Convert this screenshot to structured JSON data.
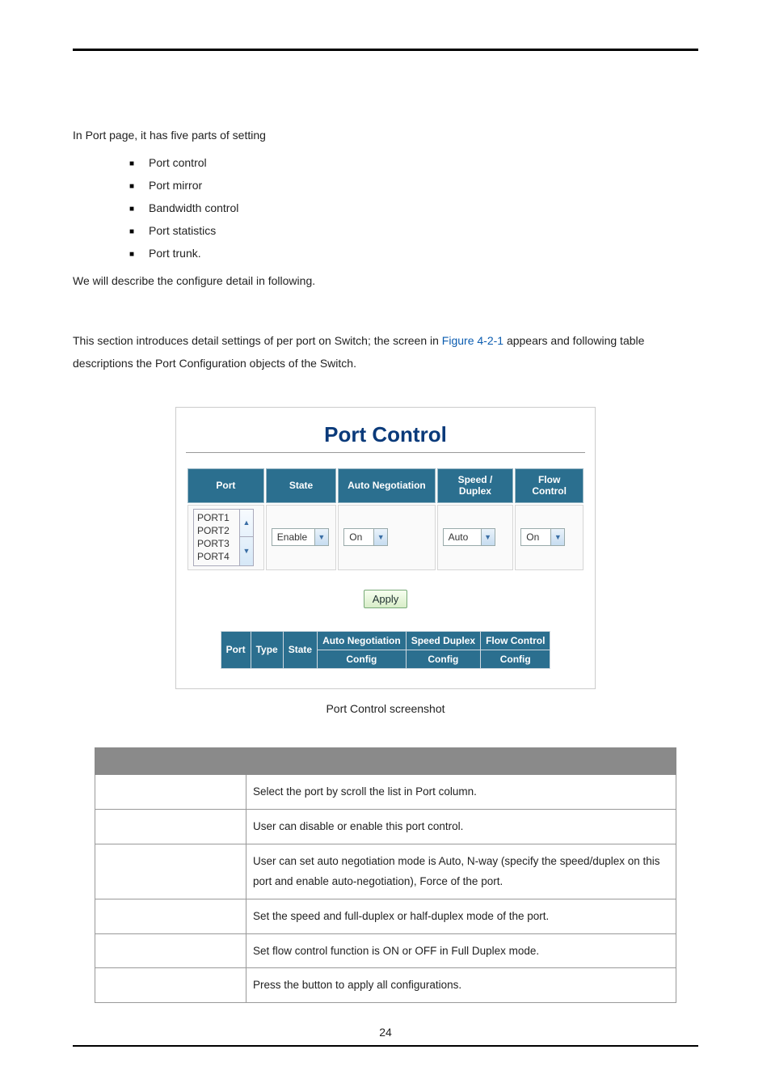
{
  "page_number": "24",
  "intro": {
    "lead": "In Port page, it has five parts of setting",
    "bullets": [
      "Port control",
      "Port mirror",
      "Bandwidth control",
      "Port statistics",
      "Port trunk."
    ],
    "follow": "We will describe the configure detail in following."
  },
  "section": {
    "pre_link": "This section introduces detail settings of per port on Switch; the screen in ",
    "link": "Figure 4-2-1",
    "post_link": " appears and following table descriptions the Port Configuration objects of the Switch."
  },
  "screenshot": {
    "title": "Port Control",
    "control_headers": {
      "port": "Port",
      "state": "State",
      "auto_neg": "Auto Negotiation",
      "speed_duplex": "Speed / Duplex",
      "flow_control": "Flow Control"
    },
    "ports": [
      "PORT1",
      "PORT2",
      "PORT3",
      "PORT4"
    ],
    "state_value": "Enable",
    "auto_neg_value": "On",
    "speed_value": "Auto",
    "flow_value": "On",
    "apply": "Apply",
    "status_headers": {
      "port": "Port",
      "type": "Type",
      "state": "State",
      "auto_neg": "Auto Negotiation",
      "speed_duplex": "Speed Duplex",
      "flow_control": "Flow Control",
      "config": "Config"
    }
  },
  "caption": "Port Control screenshot",
  "desc_rows": [
    {
      "label": "",
      "text": "Select the port by scroll the list in Port column."
    },
    {
      "label": "",
      "text": "User can disable or enable this port control."
    },
    {
      "label": "",
      "text": "User can set auto negotiation mode is Auto, N-way (specify the speed/duplex on this port and enable auto-negotiation), Force of the port."
    },
    {
      "label": "",
      "text": "Set the speed and full-duplex or half-duplex mode of the port."
    },
    {
      "label": "",
      "text": "Set flow control function is ON or OFF in Full Duplex mode."
    },
    {
      "label": "",
      "text": "Press the button to apply all configurations."
    }
  ]
}
